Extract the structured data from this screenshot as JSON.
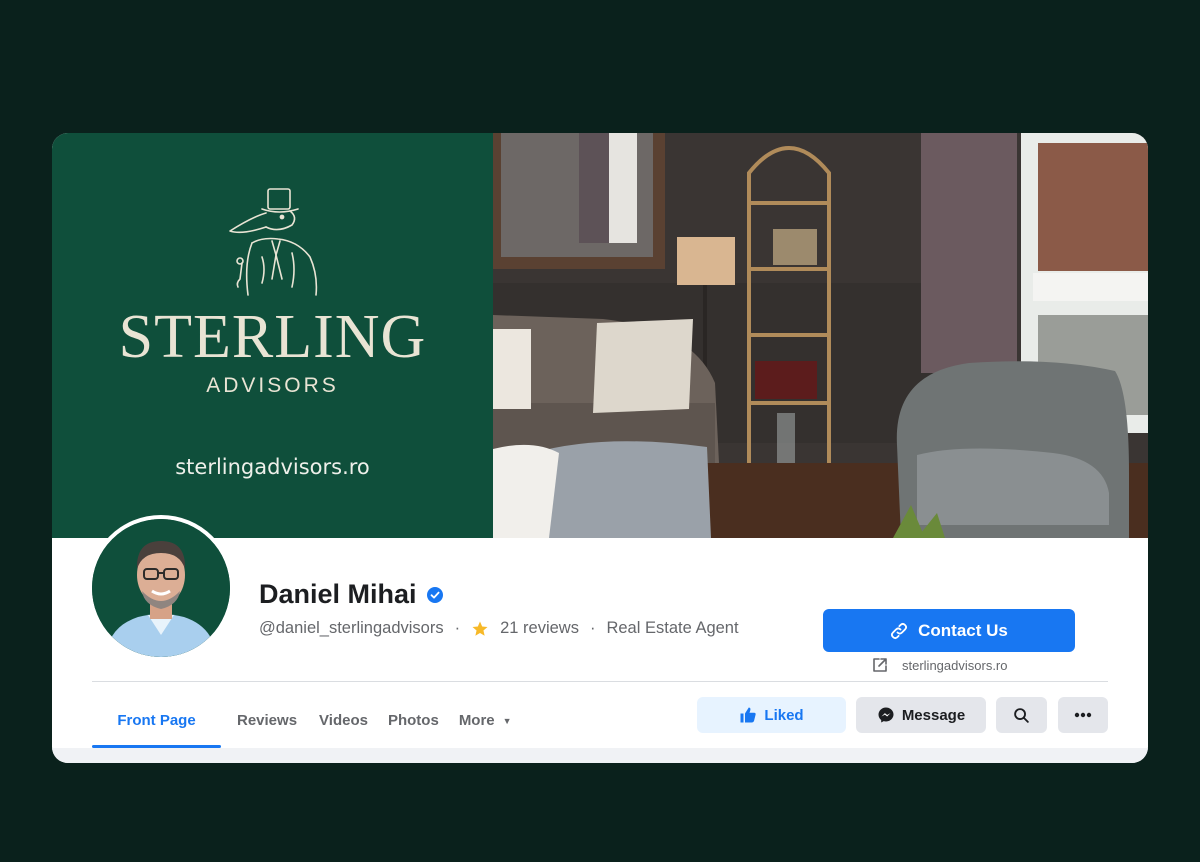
{
  "cover": {
    "brand_name": "STERLING",
    "brand_sub": "ADVISORS",
    "brand_url": "sterlingadvisors.ro",
    "mascot_icon": "crocodile-top-hat-icon",
    "photo_description_icon": "living-room-photo"
  },
  "profile": {
    "name": "Daniel Mihai",
    "verified_icon": "verified-badge-icon",
    "handle": "@daniel_sterlingadvisors",
    "separator": "·",
    "reviews": "21 reviews",
    "category": "Real Estate Agent"
  },
  "contact": {
    "button_label": "Contact Us",
    "website": "sterlingadvisors.ro"
  },
  "tabs": [
    {
      "label": "Front Page",
      "active": true
    },
    {
      "label": "Reviews"
    },
    {
      "label": "Videos"
    },
    {
      "label": "Photos"
    },
    {
      "label": "More"
    }
  ],
  "actions": {
    "liked_label": "Liked",
    "message_label": "Message"
  },
  "colors": {
    "accent": "#1877f2",
    "brand_green": "#0f4f3b",
    "page_bg": "#0a211c"
  }
}
